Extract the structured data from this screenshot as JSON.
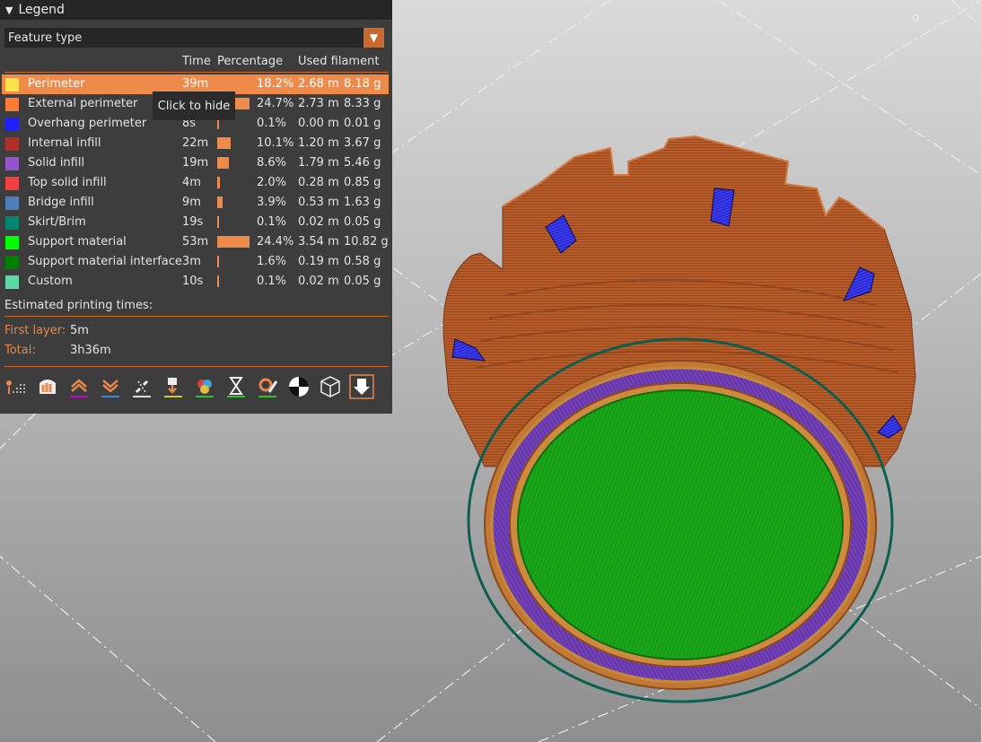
{
  "legend": {
    "title": "Legend",
    "view_type": "Feature type",
    "columns": [
      "Time",
      "Percentage",
      "Used filament"
    ],
    "tooltip": "Click to hide",
    "rows": [
      {
        "name": "Perimeter",
        "color": "#ffe14b",
        "time": "39m",
        "pct": "18.2%",
        "pct_value": 18.2,
        "length": "2.68 m",
        "weight": "8.18 g",
        "highlighted": true
      },
      {
        "name": "External perimeter",
        "color": "#ff7c38",
        "time": "",
        "pct": "24.7%",
        "pct_value": 24.7,
        "length": "2.73 m",
        "weight": "8.33 g"
      },
      {
        "name": "Overhang perimeter",
        "color": "#1f1fff",
        "time": "8s",
        "pct": "0.1%",
        "pct_value": 0.1,
        "length": "0.00 m",
        "weight": "0.01 g"
      },
      {
        "name": "Internal infill",
        "color": "#b03029",
        "time": "22m",
        "pct": "10.1%",
        "pct_value": 10.1,
        "length": "1.20 m",
        "weight": "3.67 g"
      },
      {
        "name": "Solid infill",
        "color": "#9654cc",
        "time": "19m",
        "pct": "8.6%",
        "pct_value": 8.6,
        "length": "1.79 m",
        "weight": "5.46 g"
      },
      {
        "name": "Top solid infill",
        "color": "#f04040",
        "time": "4m",
        "pct": "2.0%",
        "pct_value": 2.0,
        "length": "0.28 m",
        "weight": "0.85 g"
      },
      {
        "name": "Bridge infill",
        "color": "#4d80ba",
        "time": "9m",
        "pct": "3.9%",
        "pct_value": 3.9,
        "length": "0.53 m",
        "weight": "1.63 g"
      },
      {
        "name": "Skirt/Brim",
        "color": "#00876e",
        "time": "19s",
        "pct": "0.1%",
        "pct_value": 0.1,
        "length": "0.02 m",
        "weight": "0.05 g"
      },
      {
        "name": "Support material",
        "color": "#00ff00",
        "time": "53m",
        "pct": "24.4%",
        "pct_value": 24.4,
        "length": "3.54 m",
        "weight": "10.82 g"
      },
      {
        "name": "Support material interface",
        "color": "#008000",
        "time": "3m",
        "pct": "1.6%",
        "pct_value": 1.6,
        "length": "0.19 m",
        "weight": "0.58 g"
      },
      {
        "name": "Custom",
        "color": "#5ed9a3",
        "time": "10s",
        "pct": "0.1%",
        "pct_value": 0.1,
        "length": "0.02 m",
        "weight": "0.05 g"
      }
    ],
    "estimated_label": "Estimated printing times:",
    "first_layer_label": "First layer:",
    "first_layer_value": "5m",
    "total_label": "Total:",
    "total_value": "3h36m",
    "toolbar_icons": [
      "travel-icon",
      "wipe-icon",
      "retractions-icon",
      "deretractions-icon",
      "seams-icon",
      "tool-changes-icon",
      "color-changes-icon",
      "pause-icon",
      "custom-gcode-icon",
      "center-of-gravity-icon",
      "shells-icon",
      "tool-marker-icon"
    ]
  }
}
